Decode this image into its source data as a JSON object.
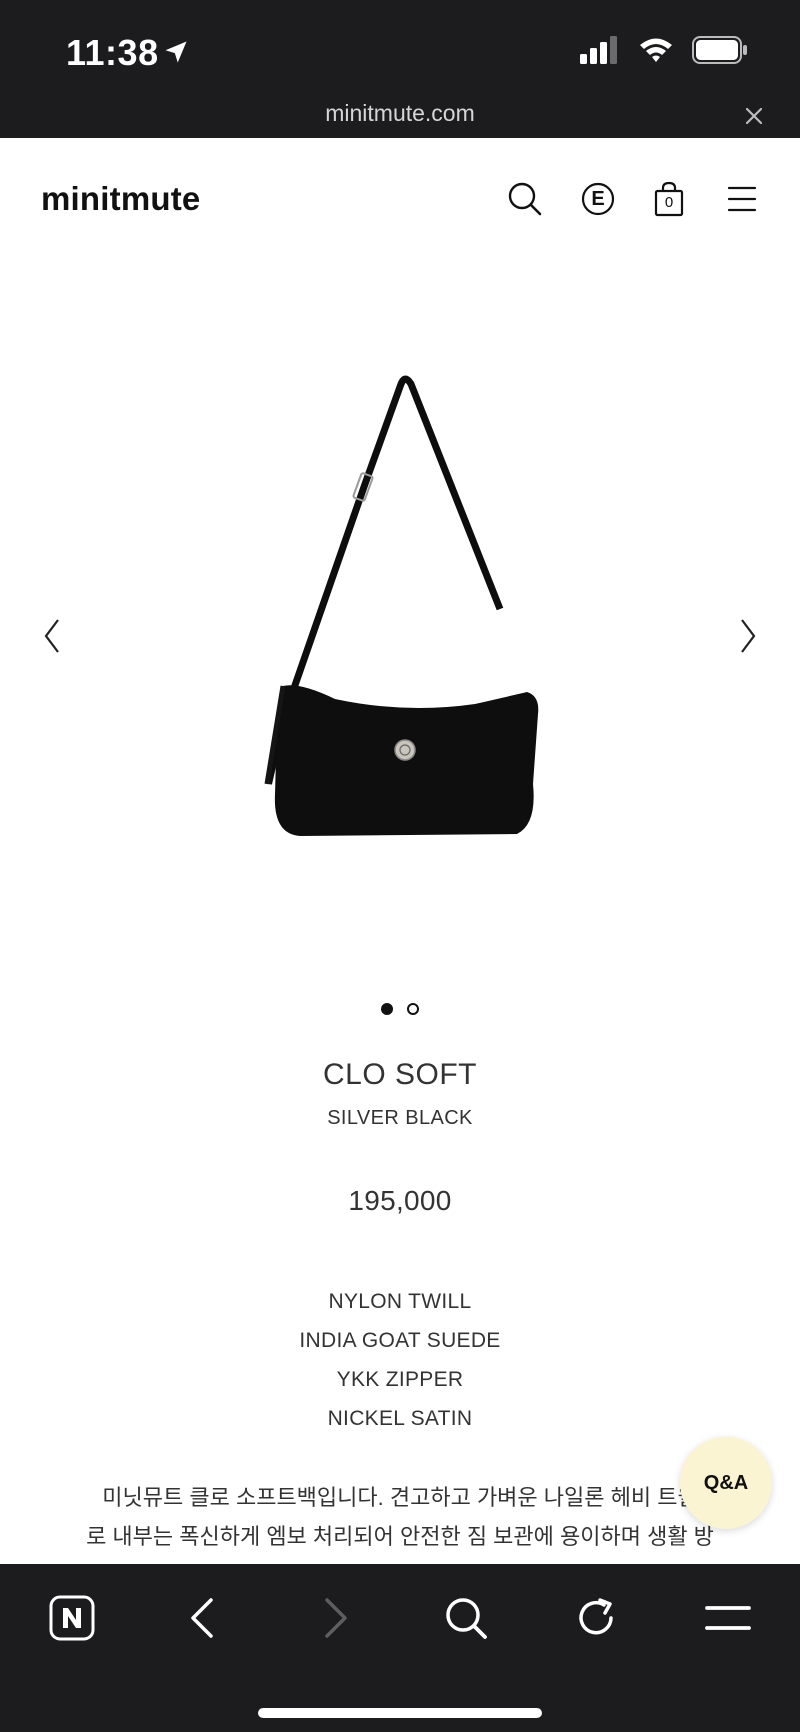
{
  "status_bar": {
    "time": "11:38",
    "icons": [
      "location-arrow-icon",
      "cellular-signal-icon",
      "wifi-icon",
      "battery-icon"
    ]
  },
  "browser": {
    "url": "minitmute.com",
    "close_icon": "close-icon"
  },
  "header": {
    "logo": "minitmute",
    "e_badge": "E",
    "cart_count": "0",
    "icons": [
      "search-icon",
      "e-badge-icon",
      "shopping-bag-icon",
      "hamburger-menu-icon"
    ]
  },
  "gallery": {
    "image": "black-nylon-shoulder-bag",
    "total_images": 2,
    "active_index": 1,
    "icons": [
      "chevron-left-icon",
      "chevron-right-icon"
    ]
  },
  "product": {
    "name": "CLO SOFT",
    "color": "SILVER BLACK",
    "price": "195,000",
    "materials": [
      "NYLON TWILL",
      "INDIA GOAT SUEDE",
      "YKK ZIPPER",
      "NICKEL SATIN"
    ],
    "description_line1": "미닛뮤트 클로 소프트백입니다. 견고하고 가벼운 나일론 헤비 트윌",
    "description_line2": "로 내부는 폭신하게 엠보 처리되어 안전한 짐 보관에 용이하며 생활 방"
  },
  "qa_button": {
    "label": "Q&A",
    "color": "#fbf4d2"
  },
  "toolbar": {
    "icons": [
      "naver-home-icon",
      "back-arrow-icon",
      "forward-arrow-icon",
      "search-icon",
      "reload-icon",
      "menu-icon"
    ]
  },
  "colors": {
    "system_bar": "#1c1c1e",
    "text": "#333333"
  }
}
